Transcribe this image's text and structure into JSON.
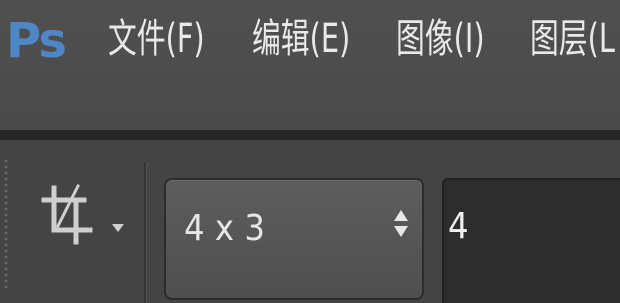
{
  "app": {
    "logo_text": "Ps",
    "accent_color": "#4f86c6"
  },
  "menubar": {
    "items": [
      {
        "label": "文件(F)"
      },
      {
        "label": "编辑(E)"
      },
      {
        "label": "图像(I)"
      },
      {
        "label": "图层(L"
      }
    ]
  },
  "options_bar": {
    "tool_icon": "crop-icon",
    "ratio_preset": "4 x 3",
    "width_value": "4"
  }
}
